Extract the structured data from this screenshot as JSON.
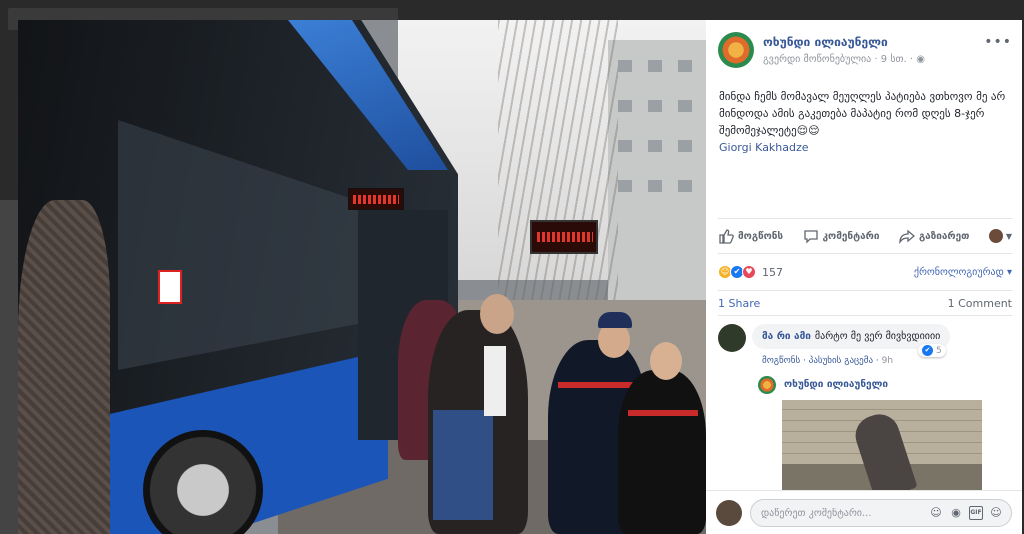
{
  "post": {
    "author": "ოხუნდი ილიაუნელი",
    "audience": "გვერდი მოწონებულია",
    "time": "9 სთ.",
    "globe_icon": "globe-icon",
    "text": "მინდა ჩემს მომავალ მეუღლეს პატიება ვთხოვო მე არ მინდოდა ამის გაკეთება მაპატიე რომ დღეს 8-ჯერ შემომეჯალეტე😌😌",
    "tag": "Giorgi Kakhadze"
  },
  "actions": {
    "like": "მოგწონს",
    "comment": "კომენტარი",
    "share": "გაზიარეთ"
  },
  "reactions": {
    "count": "157",
    "sort_label": "ქრონოლოგიურად"
  },
  "counts": {
    "shares": "1 Share",
    "comments": "1 Comment"
  },
  "comment": {
    "author": "მა რი ამი",
    "text": "მარტო მე ვერ მივხვდიიიი",
    "like_action": "მოგწონს",
    "reply_action": "პასუხის გაცემა",
    "time": "9h",
    "likes": "5"
  },
  "reply": {
    "author": "ოხუნდი ილიაუნელი"
  },
  "composer": {
    "placeholder": "დაწერეთ კომენტარი..."
  },
  "colors": {
    "link": "#385898",
    "accent": "#4267b2",
    "like_blue": "#1877f2",
    "love_red": "#e9475a",
    "haha_yellow": "#f7b125"
  }
}
